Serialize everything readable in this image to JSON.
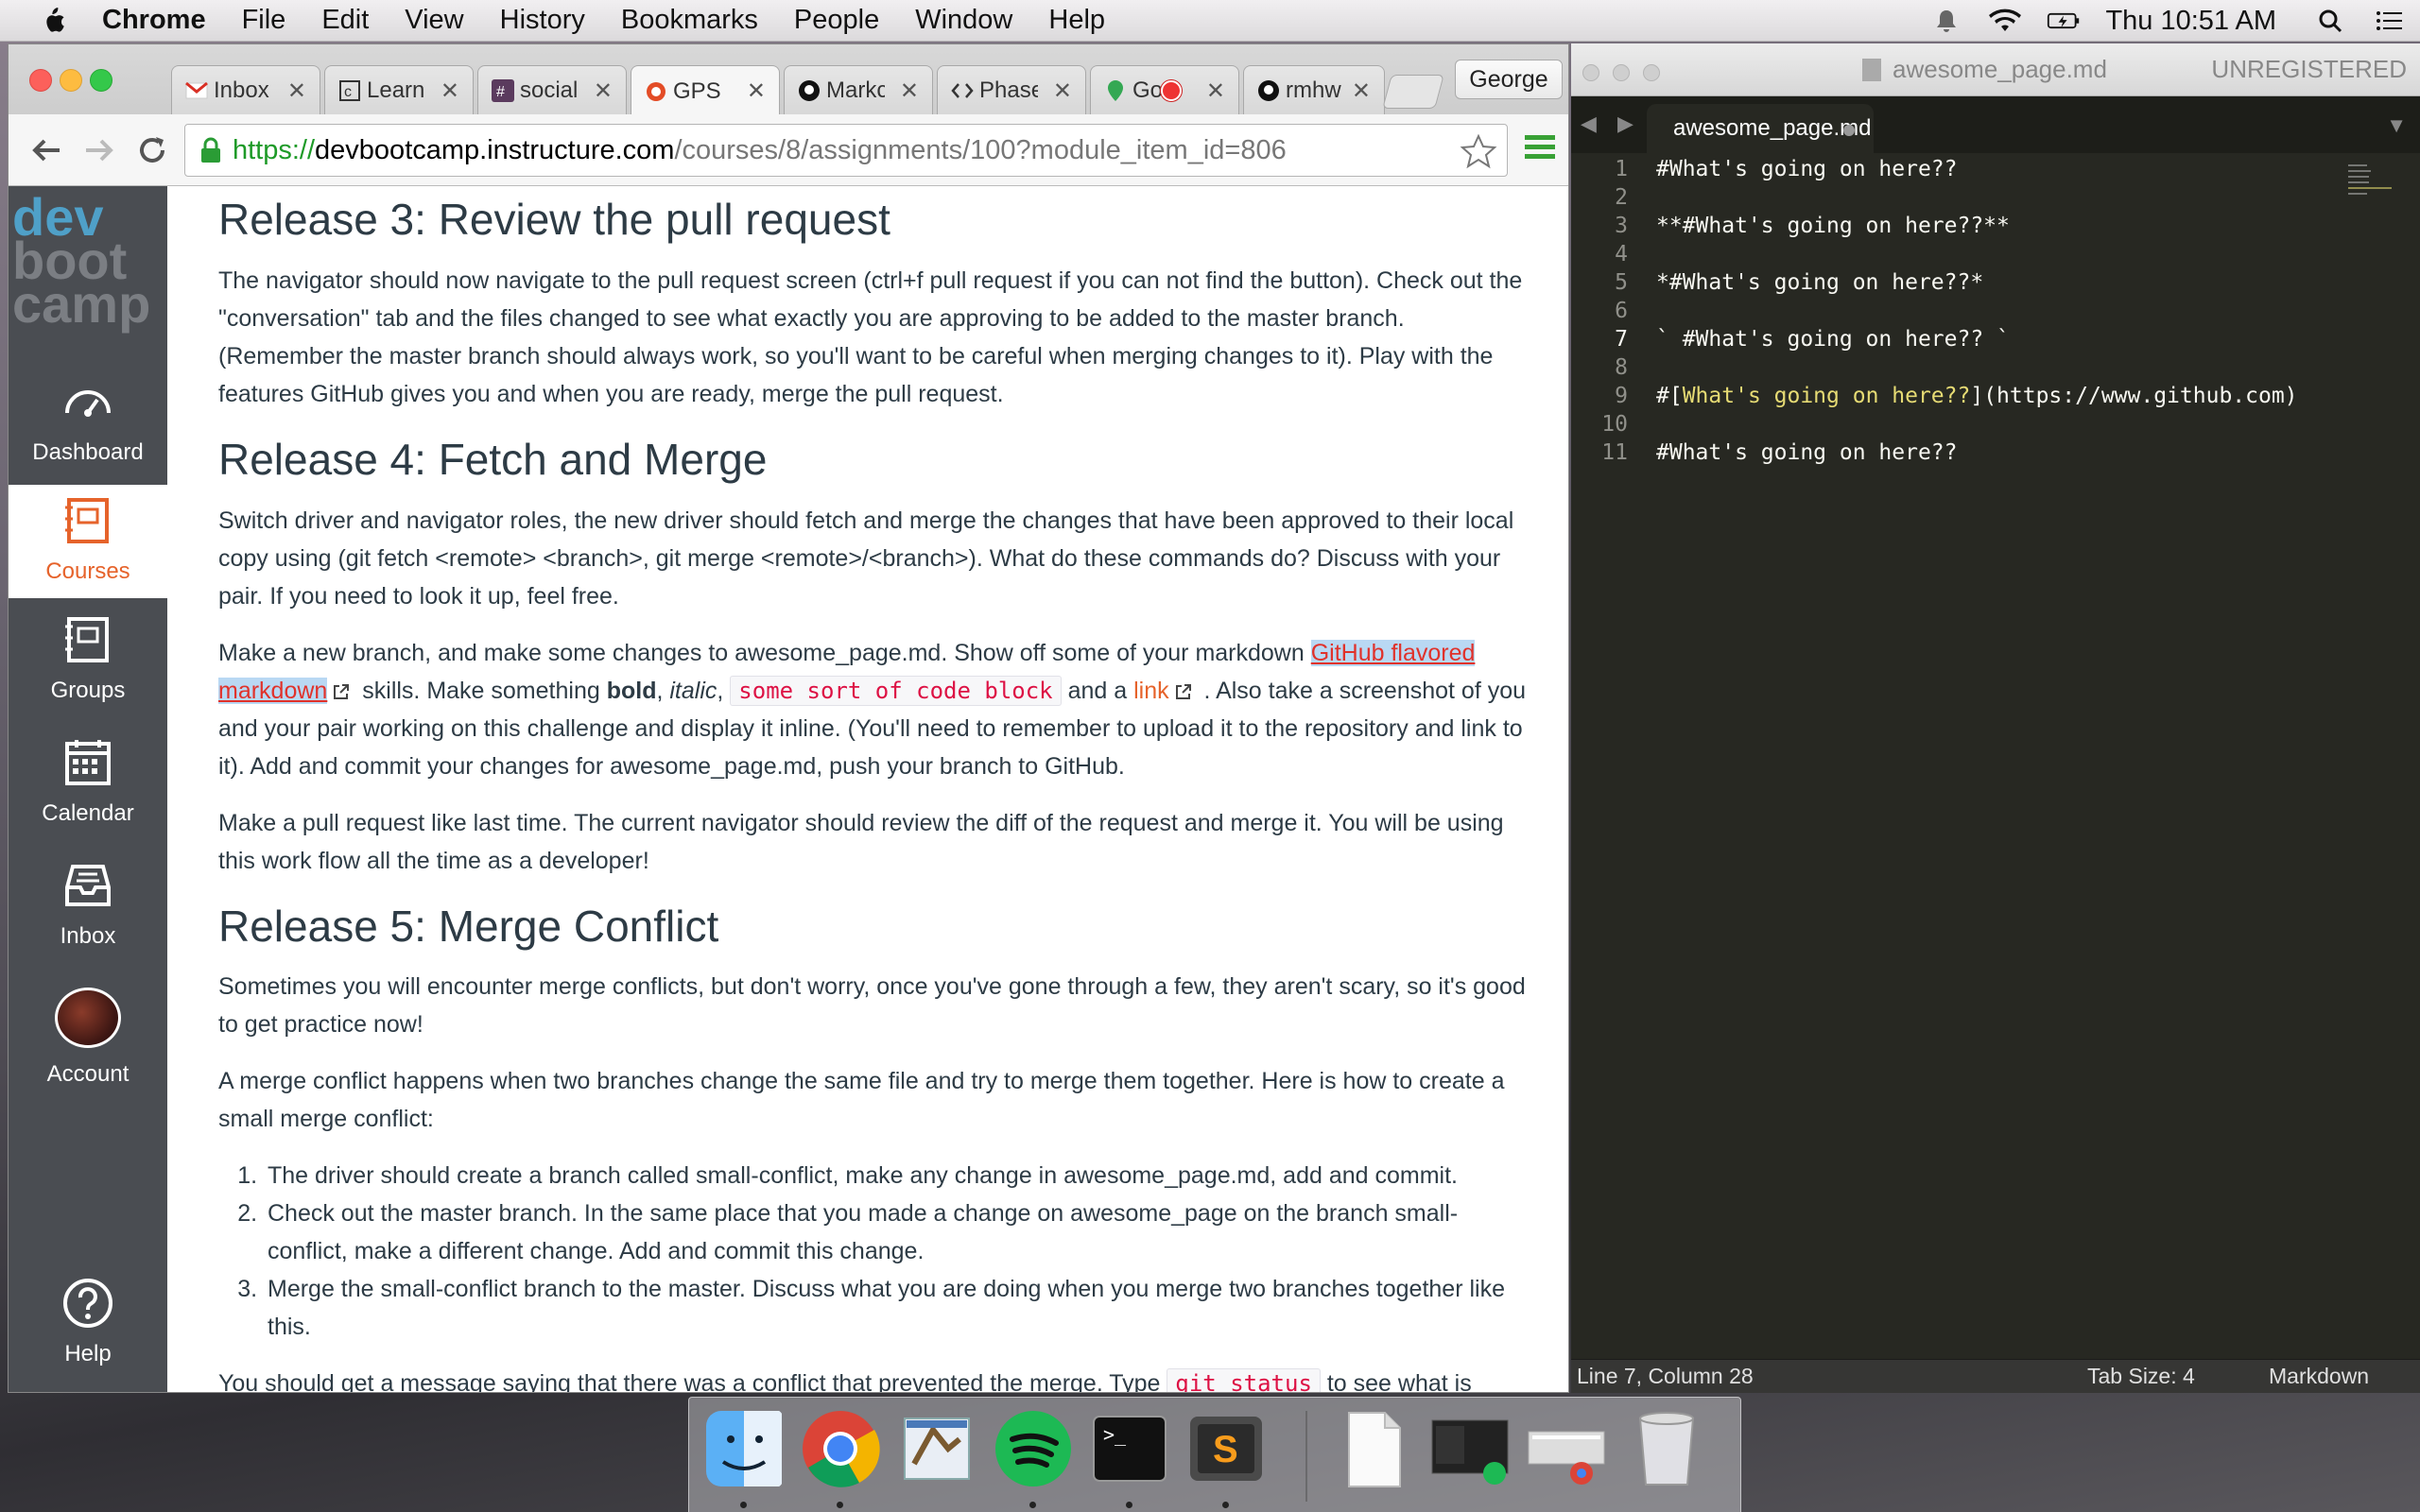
{
  "menubar": {
    "app_name": "Chrome",
    "items": [
      "File",
      "Edit",
      "View",
      "History",
      "Bookmarks",
      "People",
      "Window",
      "Help"
    ],
    "clock": "Thu 10:51 AM",
    "icons": [
      "notification-bell-icon",
      "wifi-icon",
      "battery-icon",
      "spotlight-search-icon",
      "notification-center-icon"
    ]
  },
  "chrome": {
    "tabs": [
      {
        "label": "Inbox",
        "icon": "gmail-icon"
      },
      {
        "label": "Learn",
        "icon": "canvas-icon"
      },
      {
        "label": "social",
        "icon": "slack-icon"
      },
      {
        "label": "GPS",
        "icon": "canvas-gps-icon"
      },
      {
        "label": "Markc",
        "icon": "github-icon"
      },
      {
        "label": "Phase",
        "icon": "code-icon"
      },
      {
        "label": "Go",
        "icon": "maps-icon"
      },
      {
        "label": "rmhw",
        "icon": "github-icon"
      }
    ],
    "active_tab": 3,
    "profile": "George",
    "url": {
      "scheme": "https://",
      "host": "devbootcamp.instructure.com",
      "path": "/courses/8/assignments/100?module_item_id=806"
    }
  },
  "canvas_nav": {
    "logo": [
      "dev",
      "boot",
      "camp"
    ],
    "items": [
      {
        "label": "Dashboard",
        "icon": "dashboard-icon"
      },
      {
        "label": "Courses",
        "icon": "courses-icon"
      },
      {
        "label": "Groups",
        "icon": "groups-icon"
      },
      {
        "label": "Calendar",
        "icon": "calendar-icon"
      },
      {
        "label": "Inbox",
        "icon": "inbox-icon"
      },
      {
        "label": "Account",
        "icon": "avatar"
      },
      {
        "label": "Help",
        "icon": "help-icon"
      }
    ],
    "active": "Courses"
  },
  "content": {
    "h_release3": "Release 3: Review the pull request",
    "p_release3": "The navigator should now navigate to the pull request screen (ctrl+f pull request if you can not find the button). Check out the \"conversation\" tab and the files changed to see what exactly you are approving to be added to the master branch. (Remember the master branch should always work, so you'll want to be careful when merging changes to it). Play with the features GitHub gives you and when you are ready, merge the pull request.",
    "h_release4": "Release 4: Fetch and Merge",
    "p_release4a": "Switch driver and navigator roles, the new driver should fetch and merge the changes that have been approved to their local copy using (git fetch <remote> <branch>, git merge <remote>/<branch>). What do these commands do? Discuss with your pair. If you need to look it up, feel free.",
    "p4b_1": "Make a new branch, and make some changes to awesome_page.md. Show off some of your markdown ",
    "p4b_link1": "GitHub flavored markdown",
    "p4b_2": " skills. Make something ",
    "p4b_bold": "bold",
    "p4b_3": ", ",
    "p4b_italic": "italic",
    "p4b_4": ", ",
    "p4b_code": "some sort of code block",
    "p4b_5": " and a ",
    "p4b_link2": "link",
    "p4b_6": " . Also take a screenshot of you and your pair working on this challenge and display it inline. (You'll need to remember to upload it to the repository and link to it). Add and commit your changes for awesome_page.md, push your branch to GitHub.",
    "p_release4c": "Make a pull request like last time. The current navigator should review the diff of the request and merge it. You will be using this work flow all the time as a developer!",
    "h_release5": "Release 5: Merge Conflict",
    "p_release5a": "Sometimes you will encounter merge conflicts, but don't worry, once you've gone through a few, they aren't scary, so it's good to get practice now!",
    "p_release5b": "A merge conflict happens when two branches change the same file and try to merge them together. Here is how to create a small merge conflict:",
    "steps": [
      "The driver should create a branch called small-conflict, make any change in awesome_page.md, add and commit.",
      "Check out the master branch. In the same place that you made a change on awesome_page on the branch small-conflict, make a different change. Add and commit this change.",
      "Merge the small-conflict branch to the master. Discuss what you are doing when you merge two branches together like this."
    ],
    "p5c_1": "You should get a message saying that there was a conflict that prevented the merge. Type ",
    "p5c_code": "git status",
    "p5c_2": " to see what is"
  },
  "sublime": {
    "title": "awesome_page.md",
    "unregistered": "UNREGISTERED",
    "tab_label": "awesome_page.md",
    "line_numbers": [
      "1",
      "2",
      "3",
      "4",
      "5",
      "6",
      "7",
      "8",
      "9",
      "10",
      "11"
    ],
    "current_line": 7,
    "lines": [
      "#What's going on here??",
      "",
      "**#What's going on here??**",
      "",
      "*#What's going on here??*",
      "",
      "` #What's going on here?? `",
      "",
      "",
      "",
      "#What's going on here??"
    ],
    "line9": {
      "a": "#[",
      "b": "What's going on here??",
      "c": "](https://www.github.com)"
    },
    "status_position": "Line 7, Column 28",
    "status_tabsize": "Tab Size: 4",
    "status_syntax": "Markdown"
  },
  "dock": {
    "apps": [
      "finder-icon",
      "chrome-icon",
      "mail-icon",
      "spotify-icon",
      "terminal-icon",
      "sublime-text-icon",
      "document-icon",
      "spotify-window-preview-icon",
      "chrome-window-preview-icon",
      "trash-icon"
    ]
  },
  "colors": {
    "canvas_orange": "#e6632b",
    "sidebar_bg": "#4a4d52",
    "sublime_bg": "#272822",
    "url_green": "#1e9a28"
  }
}
